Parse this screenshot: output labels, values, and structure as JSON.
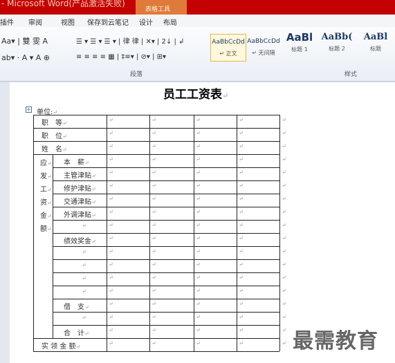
{
  "window": {
    "title": "- Microsoft Word(产品激活失败)",
    "context_tab": "表格工具"
  },
  "tabs": [
    "插件",
    "审阅",
    "视图",
    "保存到云笔记",
    "设计",
    "布局"
  ],
  "ribbon": {
    "font_row1": "Aa▾ | 雙 雯 A",
    "font_row2": "ab▾ · A ▾ A ⊕",
    "para_row1": "☰ ▾ ☰ ▾ ☰ ▾ | 律 律 | ✕▾ | 2↓ | ↲",
    "para_row2": "≡ ≡ ≡ ≡ ▦ | ‡≡▾ | ⊘▾ | ⊞▾",
    "para_group": "段落",
    "styles_group": "样式",
    "styles": [
      {
        "sample": "AaBbCcDd",
        "name": "↵ 正文"
      },
      {
        "sample": "AaBbCcDd",
        "name": "↵ 无间隔"
      },
      {
        "sample": "AaBl",
        "name": "标题 1"
      },
      {
        "sample": "AaBb(",
        "name": "标题 2"
      },
      {
        "sample": "AaBl",
        "name": "标题"
      }
    ]
  },
  "document": {
    "title": "员工工资表",
    "unit_label": "单位:",
    "vertical_label": [
      "应",
      "发",
      "工",
      "资",
      "金",
      "额"
    ],
    "rows": [
      "职　等",
      "职　位",
      "姓　名",
      "本　薪",
      "主管津贴",
      "修护津贴",
      "交通津贴",
      "外调津贴",
      "",
      "绩效奖金",
      "",
      "",
      "",
      "",
      "借　支",
      "",
      "合　计",
      "实 领 金 额"
    ]
  },
  "watermark": "最需教育"
}
